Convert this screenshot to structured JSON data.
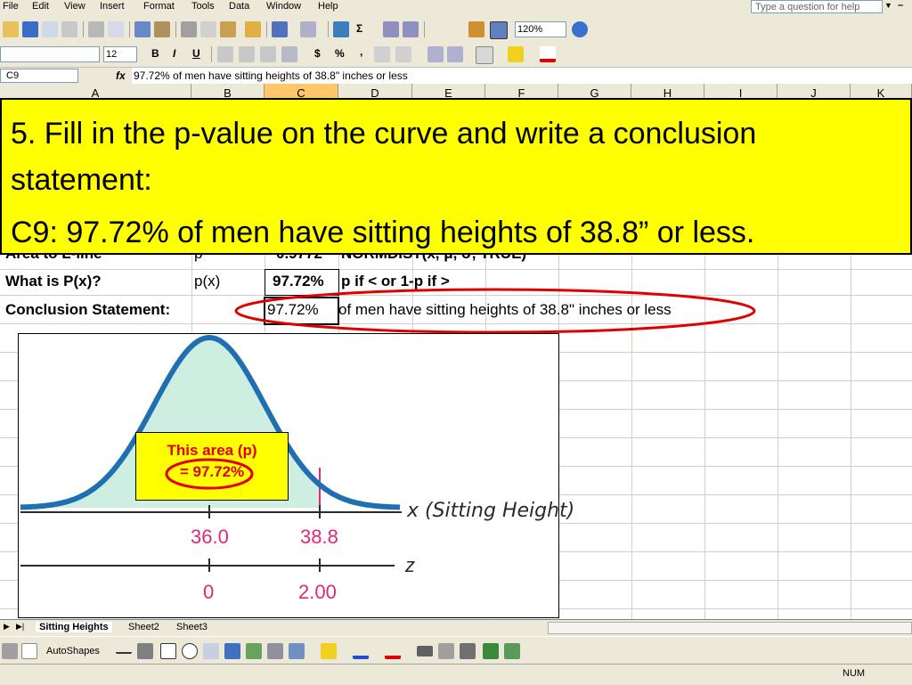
{
  "menu": {
    "items": [
      "File",
      "Edit",
      "View",
      "Insert",
      "Format",
      "Tools",
      "Data",
      "Window",
      "Help"
    ],
    "help_placeholder": "Type a question for help"
  },
  "toolbar": {
    "zoom": "120%",
    "font_size": "12",
    "bold": "B",
    "italic": "I",
    "underline": "U",
    "dollar": "$",
    "percent": "%",
    "comma": ",",
    "sigma": "Σ"
  },
  "formula_bar": {
    "name_box": "C9",
    "fx": "fx",
    "formula": "97.72% of men have sitting heights of 38.8\" inches or less"
  },
  "columns": [
    "A",
    "B",
    "C",
    "D",
    "E",
    "F",
    "G",
    "H",
    "I",
    "J",
    "K"
  ],
  "rows": {
    "r6_a": "Area to L-line",
    "r6_b": "p",
    "r6_c": "0.9772",
    "r6_d": "NORMDIST(x, μ, σ, TRUE)",
    "r7_a": "What is P(x)?",
    "r7_b": "p(x)",
    "r7_c": "97.72%",
    "r7_d": "p if  < or 1-p if  >",
    "r8_a": "Conclusion Statement:",
    "r8_c": "97.72%",
    "r8_d": "of men have sitting heights of 38.8\" inches or less"
  },
  "callout": {
    "line1": "5. Fill in the p-value on the curve and write a conclusion statement:",
    "line2": "C9: 97.72% of men have sitting heights of 38.8” or less."
  },
  "figure": {
    "x_axis_label": "x (Sitting Height)",
    "z_axis_label": "z",
    "x_ticks": [
      "36.0",
      "38.8"
    ],
    "z_ticks": [
      "0",
      "2.00"
    ],
    "area_label_line1": "This area  (p)",
    "area_label_line2": "= 97.72%",
    "curve_color": "#1f6fb2",
    "fill_color": "#cdeee0",
    "tick_label_color": "#e0287a",
    "ellipse_color": "#e00000"
  },
  "sheet_tabs": [
    "Sitting Heights",
    "Sheet2",
    "Sheet3"
  ],
  "drawing_toolbar": {
    "autoshapes": "AutoShapes"
  },
  "status": {
    "num": "NUM"
  }
}
